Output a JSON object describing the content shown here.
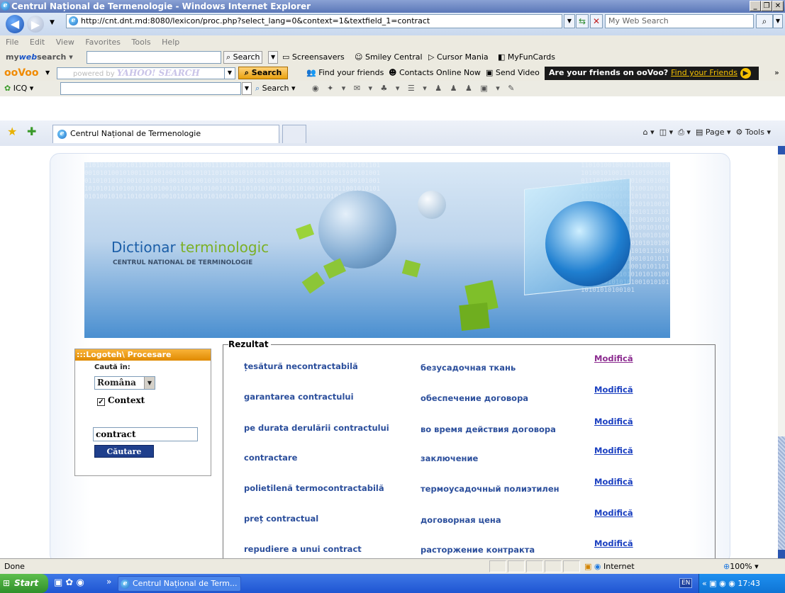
{
  "window": {
    "title": "Centrul Național de Termenologie - Windows Internet Explorer"
  },
  "address_bar": {
    "url": "http://cnt.dnt.md:8080/lexicon/proc.php?select_lang=0&context=1&textfield_1=contract",
    "search_placeholder": "My Web Search"
  },
  "menu": [
    "File",
    "Edit",
    "View",
    "Favorites",
    "Tools",
    "Help"
  ],
  "mywebsearch": {
    "brand_my": "my",
    "brand_web": "web",
    "brand_search": "search",
    "search_button": "Search",
    "items": [
      "Screensavers",
      "Smiley Central",
      "Cursor Mania",
      "MyFunCards"
    ]
  },
  "oovoo": {
    "brand": "ooVoo",
    "yahoo_powered": "powered by",
    "yahoo_brand": "YAHOO! SEARCH",
    "search_button": "Search",
    "items": [
      "Find your friends",
      "Contacts Online Now",
      "Send Video"
    ],
    "ad_text": "Are your friends on ooVoo?",
    "ad_link": "Find your Friends"
  },
  "icq_toolbar": {
    "label": "ICQ",
    "search_label": "Search"
  },
  "tabs": {
    "active_title": "Centrul Național de Termenologie"
  },
  "ie_tools": {
    "page": "Page",
    "tools": "Tools"
  },
  "banner": {
    "title_part1": "Dictionar ",
    "title_part2": "terminologic",
    "subtitle": "CENTRUL NATIONAL DE TERMINOLOGIE",
    "binary": "1101010010010110101001010100101001110101001010011101001010101001010011010110100101010010100111010100101001010110101001010101011001010100101010011010101001011010101010010101001100101010010101011010101001010100101010110100101001010011010101010100101010100101101001010010101110101010010101101001010101100101010101010010101101010101001010101010101001101010101010100101010110101010100101"
  },
  "search_panel": {
    "header": ":::Logoteh\\ Procesare",
    "search_in_label": "Caută în:",
    "language": "Româna",
    "context_checked": true,
    "context_label": "Context",
    "query": "contract",
    "search_button": "Căutare"
  },
  "results": {
    "legend": "Rezultat",
    "rows": [
      {
        "ro": "țesătură necontractabilă",
        "ru": "безусадочная ткань",
        "action": "Modifică"
      },
      {
        "ro": "garantarea contractului",
        "ru": "обеспечение договора",
        "action": "Modifică"
      },
      {
        "ro": "pe durata derulării contractului",
        "ru": "во время действия договора",
        "action": "Modifică"
      },
      {
        "ro": "contractare",
        "ru": "заключение",
        "action": "Modifică"
      },
      {
        "ro": "polietilenă termocontractabilă",
        "ru": "термоусадочный полиэтилен",
        "action": "Modifică"
      },
      {
        "ro": "preț contractual",
        "ru": "договорная цена",
        "action": "Modifică"
      },
      {
        "ro": "repudiere a unui contract",
        "ru": "расторжение контракта",
        "action": "Modifică"
      }
    ]
  },
  "status_bar": {
    "text": "Done",
    "zone": "Internet",
    "zoom": "100%"
  },
  "taskbar": {
    "start": "Start",
    "task_title": "Centrul Național de Term...",
    "lang": "EN",
    "time": "17:43"
  },
  "colors": {
    "link_visited": "#8b2a8f",
    "link": "#1a3fc0",
    "result_text": "#2c4f9c",
    "panel_header": "#f2a01a"
  }
}
